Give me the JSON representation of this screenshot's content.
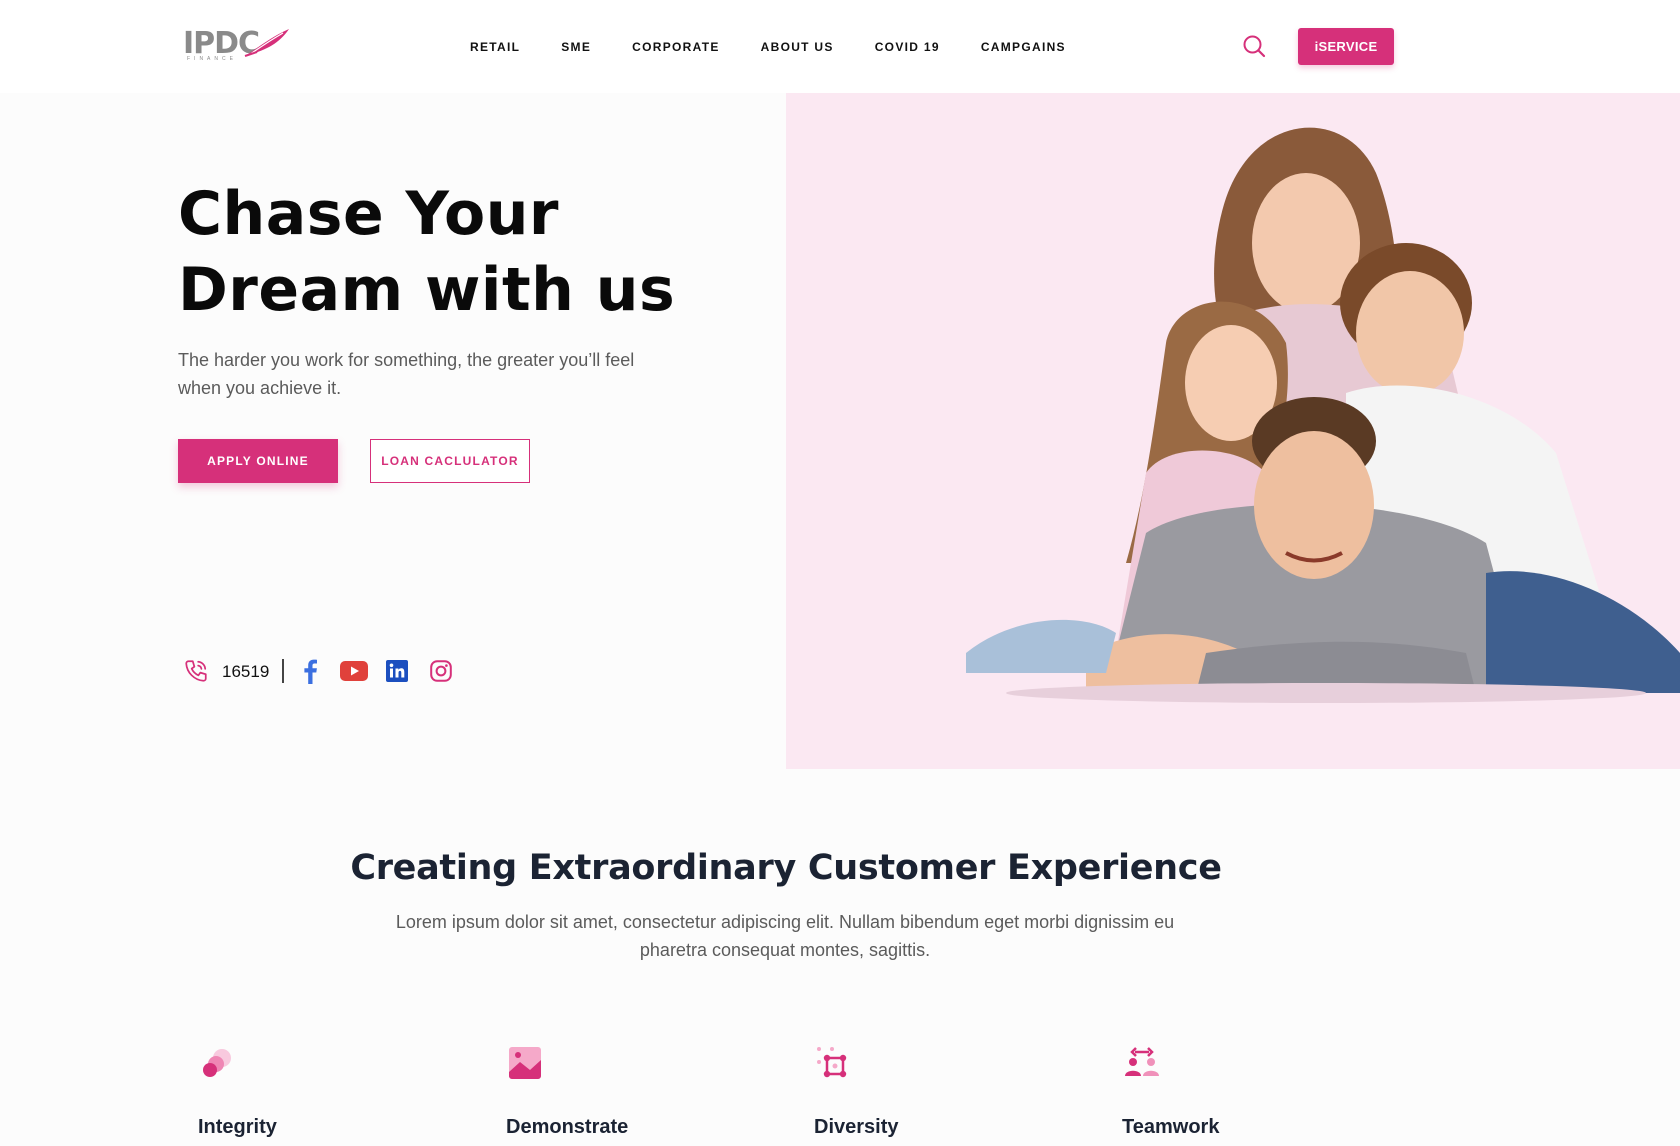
{
  "brand": {
    "logo_text": "IPDC",
    "logo_sub": "FINANCE",
    "accent": "#d6307a",
    "hero_bg": "#fbe8f2"
  },
  "nav": {
    "items": [
      "RETAIL",
      "SME",
      "CORPORATE",
      "ABOUT US",
      "COVID 19",
      "CAMPGAINS"
    ]
  },
  "header": {
    "search_icon": "search-icon",
    "iservice_label": "iSERVICE"
  },
  "hero": {
    "title_line1": "Chase Your",
    "title_line2": "Dream with us",
    "subtitle": "The harder you work for something, the greater you’ll feel when you achieve it.",
    "apply_label": "APPLY ONLINE",
    "loan_label": "LOAN CACLULATOR"
  },
  "contact": {
    "phone": "16519",
    "socials": [
      "facebook-icon",
      "youtube-icon",
      "linkedin-icon",
      "instagram-icon"
    ]
  },
  "values_section": {
    "title": "Creating Extraordinary Customer Experience",
    "subtitle": "Lorem ipsum dolor sit amet, consectetur adipiscing elit. Nullam bibendum eget morbi dignissim eu pharetra consequat montes, sagittis.",
    "items": [
      {
        "label": "Integrity",
        "icon": "circles-icon"
      },
      {
        "label": "Demonstrate",
        "icon": "image-icon"
      },
      {
        "label": "Diversity",
        "icon": "nodes-icon"
      },
      {
        "label": "Teamwork",
        "icon": "team-icon"
      }
    ]
  }
}
